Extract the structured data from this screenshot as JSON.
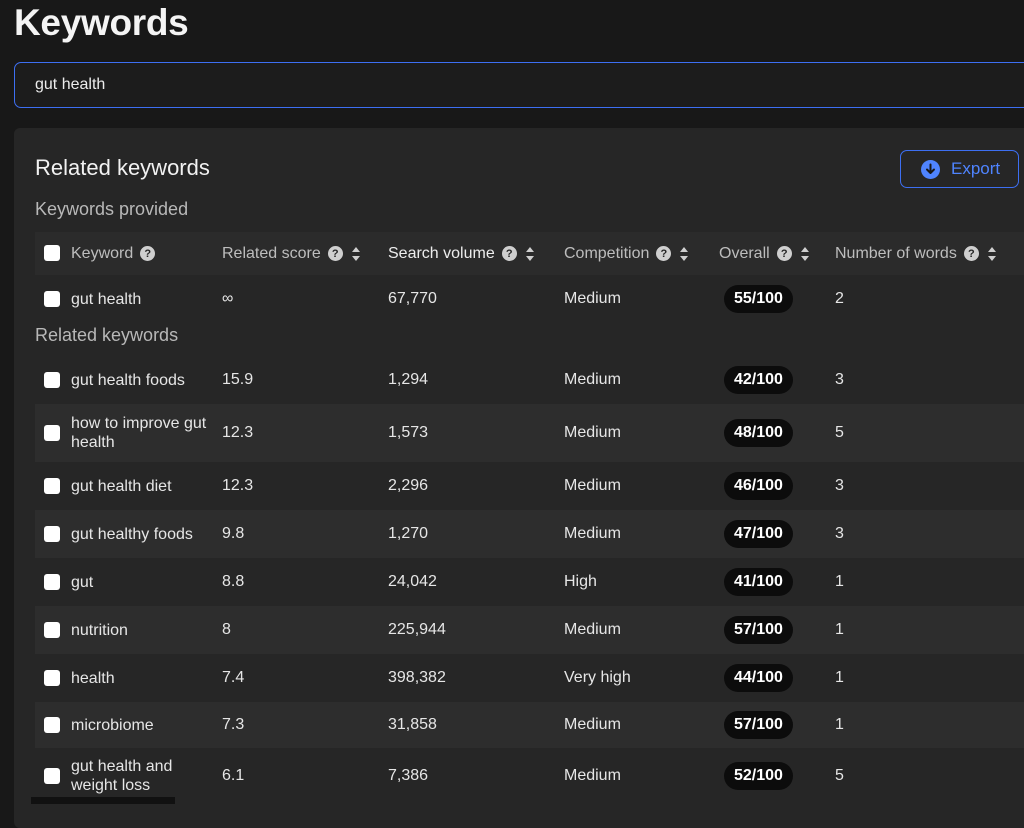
{
  "page": {
    "title": "Keywords"
  },
  "search": {
    "value": "gut health"
  },
  "panel": {
    "title": "Related keywords",
    "export_label": "Export"
  },
  "sections": {
    "provided": "Keywords provided",
    "related": "Related keywords"
  },
  "columns": {
    "keyword": "Keyword",
    "related_score": "Related score",
    "search_volume": "Search volume",
    "competition": "Competition",
    "overall": "Overall",
    "words": "Number of words"
  },
  "provided_rows": [
    {
      "keyword": "gut health",
      "related_score": "∞",
      "search_volume": "67,770",
      "competition": "Medium",
      "overall": "55/100",
      "words": "2"
    }
  ],
  "related_rows": [
    {
      "keyword": "gut health foods",
      "related_score": "15.9",
      "search_volume": "1,294",
      "competition": "Medium",
      "overall": "42/100",
      "words": "3"
    },
    {
      "keyword": "how to improve gut health",
      "related_score": "12.3",
      "search_volume": "1,573",
      "competition": "Medium",
      "overall": "48/100",
      "words": "5"
    },
    {
      "keyword": "gut health diet",
      "related_score": "12.3",
      "search_volume": "2,296",
      "competition": "Medium",
      "overall": "46/100",
      "words": "3"
    },
    {
      "keyword": "gut healthy foods",
      "related_score": "9.8",
      "search_volume": "1,270",
      "competition": "Medium",
      "overall": "47/100",
      "words": "3"
    },
    {
      "keyword": "gut",
      "related_score": "8.8",
      "search_volume": "24,042",
      "competition": "High",
      "overall": "41/100",
      "words": "1"
    },
    {
      "keyword": "nutrition",
      "related_score": "8",
      "search_volume": "225,944",
      "competition": "Medium",
      "overall": "57/100",
      "words": "1"
    },
    {
      "keyword": "health",
      "related_score": "7.4",
      "search_volume": "398,382",
      "competition": "Very high",
      "overall": "44/100",
      "words": "1"
    },
    {
      "keyword": "microbiome",
      "related_score": "7.3",
      "search_volume": "31,858",
      "competition": "Medium",
      "overall": "57/100",
      "words": "1"
    },
    {
      "keyword": "gut health and weight loss",
      "related_score": "6.1",
      "search_volume": "7,386",
      "competition": "Medium",
      "overall": "52/100",
      "words": "5"
    }
  ],
  "colors": {
    "accent": "#3d6ff2",
    "background": "#181818",
    "panel": "#262626"
  }
}
